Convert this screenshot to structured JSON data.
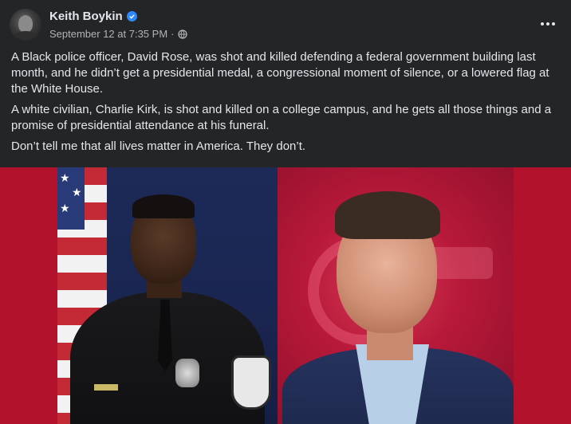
{
  "post": {
    "author": "Keith Boykin",
    "date": "September 12 at 7:35 PM",
    "separator": "·",
    "paragraphs": [
      "A Black police officer, David Rose, was shot and killed defending a federal government building last month, and he didn’t get a presidential medal, a congressional moment of silence, or a lowered flag at the White House.",
      "A white civilian, Charlie Kirk, is shot and killed on a college campus, and he gets all those things and a promise of presidential attendance at his funeral.",
      "Don’t tell me that all lives matter in America. They don’t."
    ]
  },
  "icons": {
    "verified": "verified-badge-icon",
    "audience": "globe-icon",
    "more": "more-options-icon"
  },
  "colors": {
    "background": "#242526",
    "text": "#e4e6eb",
    "secondary_text": "#b0b3b8",
    "verified": "#2d88ff",
    "photo_background": "#b2122b"
  }
}
